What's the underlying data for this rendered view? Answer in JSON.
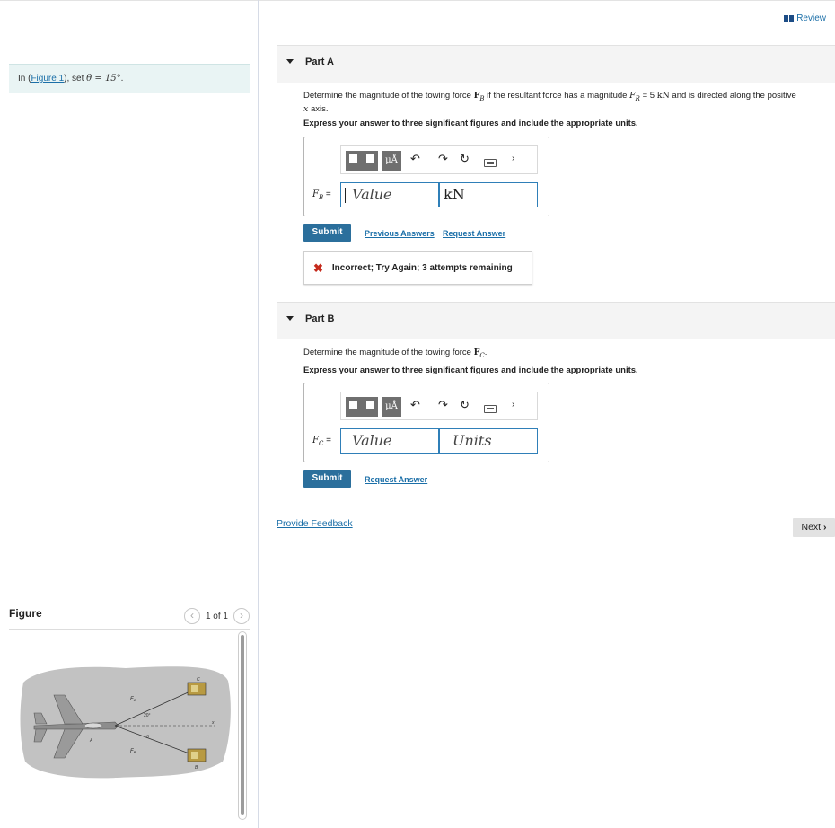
{
  "problem": {
    "prefix": "In (",
    "figure_link": "Figure 1",
    "suffix": "), set ",
    "theta": "θ = 15°",
    "period": "."
  },
  "figure": {
    "title": "Figure",
    "pager_text": "1 of 1",
    "labels": {
      "fc": "F",
      "fc_sub": "C",
      "fb": "F",
      "fb_sub": "B",
      "angle": "20°",
      "theta": "θ",
      "x": "x",
      "a": "A",
      "b": "B",
      "c": "C"
    }
  },
  "review": {
    "label": "Review"
  },
  "partA": {
    "title": "Part A",
    "q_pre": "Determine the magnitude of the towing force ",
    "q_force": "F",
    "q_force_sub": "B",
    "q_mid": " if the resultant force has a magnitude ",
    "q_fr": "F",
    "q_fr_sub": "R",
    "q_val": " = 5 ",
    "q_unit": "kN",
    "q_post": " and is directed along the positive",
    "q_line2_var": "x",
    "q_line2": " axis.",
    "instruction": "Express your answer to three significant figures and include the appropriate units.",
    "var_label": "F",
    "var_sub": "B",
    "var_eq": " =",
    "value_placeholder": "Value",
    "units_value": "kN",
    "submit": "Submit",
    "prev_answers": "Previous Answers",
    "request_answer": "Request Answer",
    "feedback": "Incorrect; Try Again; 3 attempts remaining"
  },
  "partB": {
    "title": "Part B",
    "q_pre": "Determine the magnitude of the towing force ",
    "q_force": "F",
    "q_force_sub": "C",
    "q_post": ".",
    "instruction": "Express your answer to three significant figures and include the appropriate units.",
    "var_label": "F",
    "var_sub": "C",
    "var_eq": " =",
    "value_placeholder": "Value",
    "units_placeholder": "Units",
    "submit": "Submit",
    "request_answer": "Request Answer"
  },
  "toolbar": {
    "mu_label": "μÅ"
  },
  "footer": {
    "provide_feedback": "Provide Feedback",
    "next": "Next"
  },
  "colors": {
    "accent": "#2b6f9c",
    "link": "#1b6fa8",
    "error": "#c52a1c",
    "problem_bg": "#e9f4f4"
  }
}
